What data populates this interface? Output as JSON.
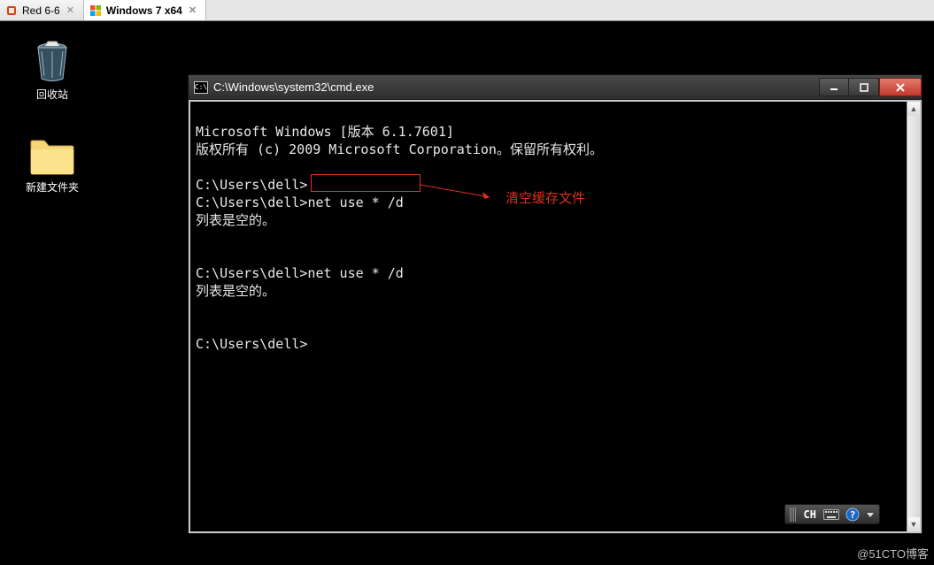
{
  "vm_tabs": [
    {
      "label": "Red 6-6",
      "active": false
    },
    {
      "label": "Windows 7 x64",
      "active": true
    }
  ],
  "desktop": {
    "icons": [
      {
        "name": "recycle-bin",
        "label": "回收站"
      },
      {
        "name": "new-folder",
        "label": "新建文件夹"
      }
    ]
  },
  "cmd": {
    "title_prefix": "C:\\Windows\\system32\\cmd.exe",
    "lines": {
      "l0": "Microsoft Windows [版本 6.1.7601]",
      "l1": "版权所有 (c) 2009 Microsoft Corporation。保留所有权利。",
      "l2": "",
      "l3": "C:\\Users\\dell>",
      "l4a": "C:\\Users\\dell>",
      "l4b": "net use * /d",
      "l5": "列表是空的。",
      "l6": "",
      "l7": "",
      "l8": "C:\\Users\\dell>net use * /d",
      "l9": "列表是空的。",
      "l10": "",
      "l11": "",
      "l12": "C:\\Users\\dell>"
    }
  },
  "annotation": {
    "text": "清空缓存文件"
  },
  "ime": {
    "lang": "CH"
  },
  "watermark": "@51CTO博客"
}
